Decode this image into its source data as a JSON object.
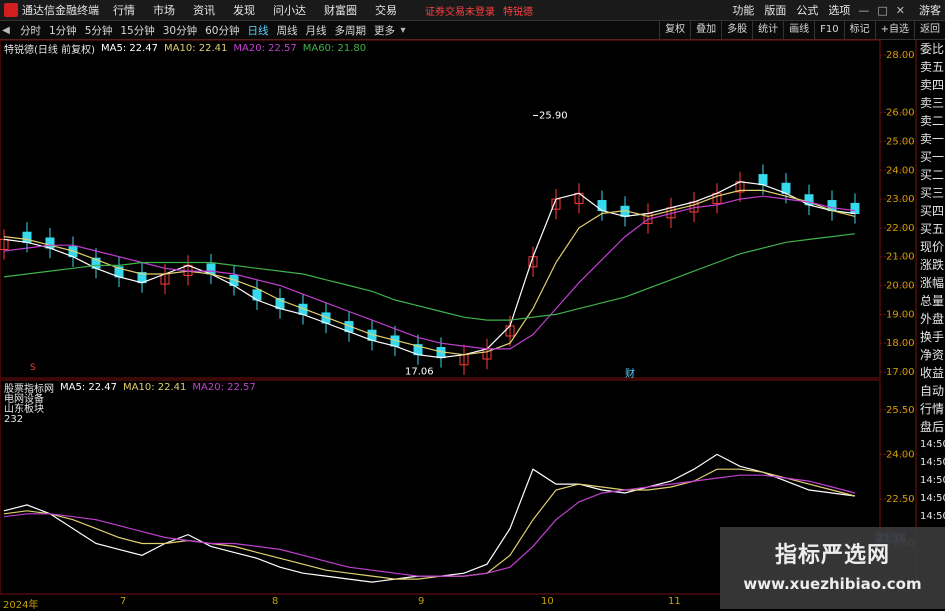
{
  "menubar": {
    "app_title": "通达信金融终端",
    "items": [
      "行情",
      "市场",
      "资讯",
      "发现",
      "问小达",
      "财富圈",
      "交易"
    ],
    "login_warning": "证券交易未登录",
    "username": "特锐德",
    "right_items": [
      "功能",
      "版面",
      "公式",
      "选项"
    ],
    "guest": "游客"
  },
  "toolbar": {
    "periods": [
      "分时",
      "1分钟",
      "5分钟",
      "15分钟",
      "30分钟",
      "60分钟",
      "日线",
      "周线",
      "月线",
      "多周期",
      "更多"
    ],
    "active_period": "日线",
    "right_buttons": [
      "复权",
      "叠加",
      "多股",
      "统计",
      "画线",
      "F10",
      "标记",
      "+自选",
      "返回"
    ]
  },
  "price_legend": {
    "stock": "特锐德(日线 前复权)",
    "ma5": "MA5: 22.47",
    "ma10": "MA10: 22.41",
    "ma20": "MA20: 22.57",
    "ma60": "MA60: 21.80"
  },
  "colors": {
    "up": "#ff3b3b",
    "down": "#37d9ee",
    "ma5": "#ffffff",
    "ma10": "#e0d070",
    "ma20": "#c040d0",
    "ma60": "#3fb24a",
    "axis_text": "#c8a000",
    "grid": "#7a1010"
  },
  "price_axis": {
    "ticks": [
      "28.00",
      "26.00",
      "25.00",
      "24.00",
      "23.00",
      "22.00",
      "21.00",
      "20.00",
      "19.00",
      "18.00",
      "17.00"
    ],
    "high_label": "25.90",
    "low_label": "17.06",
    "marker_left": "S",
    "marker_right": "财"
  },
  "indicator": {
    "title": "股票指标网",
    "ma5": "MA5: 22.47",
    "ma10": "MA10: 22.41",
    "ma20": "MA20: 22.57",
    "notes": [
      "电网设备",
      "山东板块",
      "232"
    ],
    "ticks": [
      "25.50",
      "24.00",
      "22.50",
      "21.00"
    ],
    "current_value": "21.16"
  },
  "right_list": [
    "委比",
    "卖五",
    "卖四",
    "卖三",
    "卖二",
    "卖一",
    "买一",
    "买二",
    "买三",
    "买四",
    "买五",
    "现价",
    "涨跌",
    "涨幅",
    "总量",
    "外盘",
    "换手",
    "净资",
    "收益",
    "自动",
    "行情",
    "盘后",
    "14:50",
    "14:50",
    "14:50",
    "14:50",
    "14:50"
  ],
  "dates": [
    "2024年",
    "7",
    "8",
    "9",
    "10",
    "11"
  ],
  "watermark": {
    "title": "指标严选网",
    "url": "www.xuezhibiao.com"
  },
  "chart_data": [
    {
      "type": "candlestick",
      "title": "特锐德(日线 前复权)",
      "yrange": [
        17.0,
        28.0
      ],
      "series": [
        {
          "name": "MA5",
          "values": [
            21.6,
            21.5,
            21.3,
            21.0,
            20.6,
            20.3,
            20.1,
            20.4,
            20.7,
            20.4,
            20.0,
            19.5,
            19.2,
            19.0,
            18.7,
            18.4,
            18.1,
            17.9,
            17.6,
            17.5,
            17.6,
            17.8,
            18.6,
            21.0,
            23.0,
            23.2,
            22.6,
            22.4,
            22.5,
            22.7,
            22.9,
            23.2,
            23.6,
            23.5,
            23.2,
            22.8,
            22.6,
            22.5
          ]
        },
        {
          "name": "MA10",
          "values": [
            21.7,
            21.6,
            21.4,
            21.2,
            20.9,
            20.6,
            20.4,
            20.4,
            20.5,
            20.4,
            20.2,
            19.9,
            19.5,
            19.2,
            18.9,
            18.6,
            18.3,
            18.1,
            17.9,
            17.7,
            17.6,
            17.7,
            18.0,
            19.2,
            20.8,
            22.0,
            22.5,
            22.6,
            22.4,
            22.6,
            22.8,
            23.1,
            23.3,
            23.3,
            23.1,
            22.9,
            22.6,
            22.4
          ]
        },
        {
          "name": "MA20",
          "values": [
            21.2,
            21.3,
            21.4,
            21.4,
            21.2,
            21.0,
            20.8,
            20.6,
            20.5,
            20.5,
            20.4,
            20.2,
            20.0,
            19.7,
            19.4,
            19.1,
            18.8,
            18.5,
            18.2,
            18.0,
            17.9,
            17.8,
            17.8,
            18.3,
            19.2,
            20.1,
            20.9,
            21.7,
            22.3,
            22.5,
            22.7,
            22.8,
            23.0,
            23.1,
            23.0,
            22.9,
            22.7,
            22.6
          ]
        },
        {
          "name": "MA60",
          "values": [
            20.3,
            20.4,
            20.5,
            20.6,
            20.7,
            20.7,
            20.8,
            20.8,
            20.8,
            20.8,
            20.7,
            20.6,
            20.5,
            20.4,
            20.2,
            20.0,
            19.8,
            19.5,
            19.3,
            19.1,
            18.9,
            18.8,
            18.8,
            18.9,
            19.0,
            19.2,
            19.4,
            19.6,
            19.9,
            20.2,
            20.5,
            20.8,
            21.1,
            21.3,
            21.5,
            21.6,
            21.7,
            21.8
          ]
        }
      ]
    },
    {
      "type": "line",
      "title": "股票指标网",
      "yrange": [
        19.5,
        26.0
      ],
      "series": [
        {
          "name": "MA5",
          "values": [
            22.1,
            22.3,
            22.0,
            21.5,
            21.0,
            20.8,
            20.6,
            21.0,
            21.3,
            20.9,
            20.7,
            20.5,
            20.2,
            20.0,
            19.9,
            19.8,
            19.7,
            19.8,
            19.9,
            19.9,
            20.0,
            20.3,
            21.5,
            23.5,
            23.0,
            23.0,
            22.8,
            22.7,
            22.9,
            23.1,
            23.5,
            24.0,
            23.6,
            23.4,
            23.1,
            22.8,
            22.7,
            22.6
          ]
        },
        {
          "name": "MA10",
          "values": [
            22.0,
            22.1,
            22.0,
            21.8,
            21.5,
            21.2,
            21.0,
            21.0,
            21.1,
            21.0,
            20.9,
            20.7,
            20.5,
            20.3,
            20.1,
            20.0,
            19.9,
            19.8,
            19.8,
            19.9,
            19.9,
            20.0,
            20.6,
            21.8,
            22.8,
            23.0,
            22.9,
            22.8,
            22.8,
            22.9,
            23.1,
            23.5,
            23.5,
            23.4,
            23.2,
            23.0,
            22.8,
            22.6
          ]
        },
        {
          "name": "MA20",
          "values": [
            21.9,
            22.0,
            22.0,
            21.9,
            21.8,
            21.6,
            21.4,
            21.2,
            21.1,
            21.0,
            21.0,
            20.9,
            20.8,
            20.6,
            20.4,
            20.2,
            20.1,
            20.0,
            19.9,
            19.9,
            19.9,
            20.0,
            20.2,
            20.9,
            21.8,
            22.4,
            22.7,
            22.8,
            22.9,
            23.0,
            23.1,
            23.2,
            23.3,
            23.3,
            23.2,
            23.1,
            22.9,
            22.7
          ]
        }
      ]
    }
  ]
}
